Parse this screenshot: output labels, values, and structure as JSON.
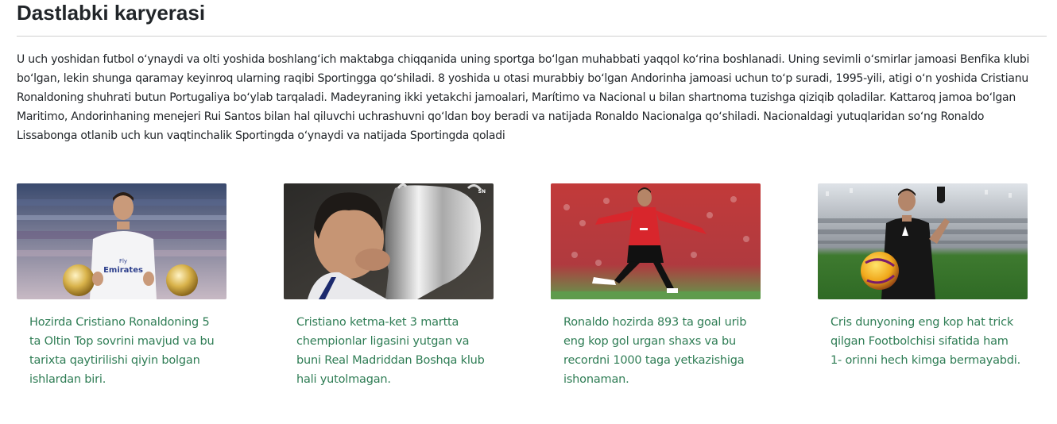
{
  "section": {
    "title": "Dastlabki karyerasi",
    "paragraph": "U uch yoshidan futbol oʻynaydi va olti yoshida boshlangʻich maktabga chiqqanida uning sportga boʻlgan muhabbati yaqqol koʻrina boshlanadi. Uning sevimli oʻsmirlar jamoasi Benfika klubi boʻlgan, lekin shunga qaramay keyinroq ularning raqibi Sportingga qoʻshiladi. 8 yoshida u otasi murabbiy boʻlgan Andorinha jamoasi uchun toʻp suradi, 1995-yili, atigi oʻn yoshida Cristianu Ronaldoning shuhrati butun Portugaliya boʻylab tarqaladi. Madeyraning ikki yetakchi jamoalari, Marítimo va Nacional u bilan shartnoma tuzishga qiziqib qoladilar. Kattaroq jamoa boʻlgan Maritimo, Andorinhaning menejeri Rui Santos bilan hal qiluvchi uchrashuvni qoʻldan boy beradi va natijada Ronaldo Nacionalga qoʻshiladi. Nacionaldagi yutuqlaridan soʻng Ronaldo Lissabonga otlanib uch kun vaqtinchalik Sportingda oʻynaydi va natijada Sportingda qoladi"
  },
  "colors": {
    "caption": "#2f7d55",
    "divider": "#cfcfcf",
    "text": "#212529"
  },
  "cards": [
    {
      "image_icon": "ronaldo-real-madrid-ballon-dor-photo",
      "caption": "Hozirda Cristiano Ronaldoning 5 ta Oltin Top sovrini mavjud va bu tarixta qaytirilishi qiyin bolgan ishlardan biri."
    },
    {
      "image_icon": "ronaldo-kissing-champions-league-trophy-photo",
      "image_badge": "SN",
      "caption": "Cristiano ketma-ket 3 martta chempionlar ligasini yutgan va buni Real Madriddan Boshqa klub hali yutolmagan."
    },
    {
      "image_icon": "ronaldo-manchester-united-kicking-photo",
      "caption": "Ronaldo hozirda 893 ta goal urib eng kop gol urgan shaxs va bu recordni 1000 taga yetkazishiga ishonaman."
    },
    {
      "image_icon": "ronaldo-juventus-hat-trick-ball-photo",
      "caption": "Cris dunyoning eng kop hat trick qilgan Footbolchisi sifatida ham 1- orinni hech kimga bermayabdi."
    }
  ]
}
